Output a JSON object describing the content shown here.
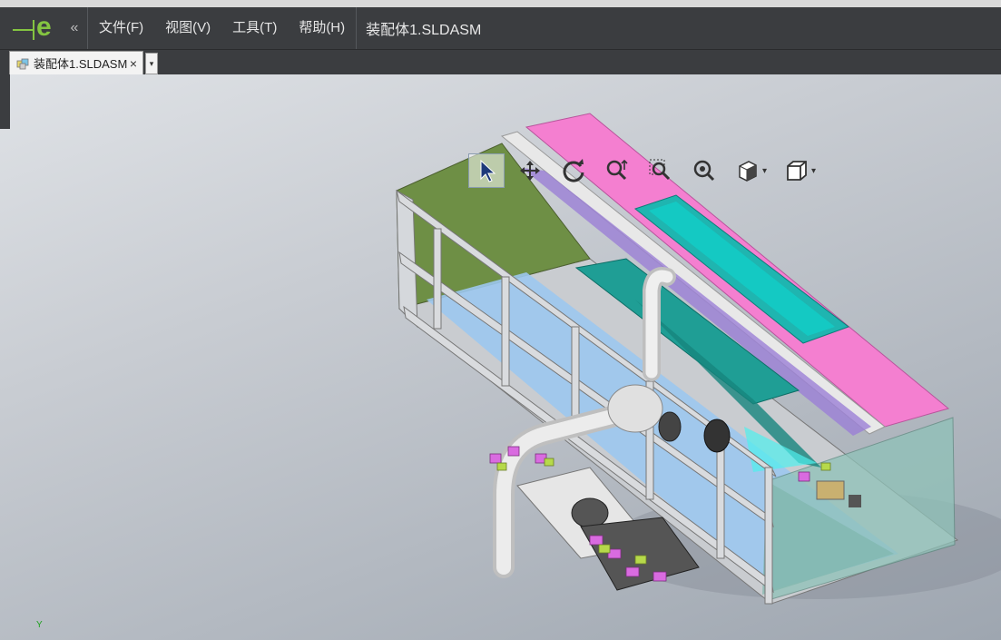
{
  "menu": {
    "items": [
      {
        "label": "文件(F)"
      },
      {
        "label": "视图(V)"
      },
      {
        "label": "工具(T)"
      },
      {
        "label": "帮助(H)"
      }
    ],
    "document_title": "装配体1.SLDASM"
  },
  "tabs": [
    {
      "label": "装配体1.SLDASM",
      "close": "×"
    }
  ],
  "tab_dropdown": "▾",
  "toolbar": {
    "icons": [
      "select-arrow-icon",
      "pan-icon",
      "rotate-icon",
      "zoom-icon",
      "zoom-area-icon",
      "zoom-fit-icon",
      "display-style-icon",
      "view-orientation-icon"
    ]
  },
  "triad": {
    "axis_label": "Y"
  },
  "colors": {
    "header_bg": "#3b3d40",
    "logo_green": "#84c441",
    "accent_pink": "#f47fd0",
    "accent_teal": "#1fb5b0",
    "panel_green": "#6e8f45",
    "water_blue": "#9cc8ee"
  }
}
